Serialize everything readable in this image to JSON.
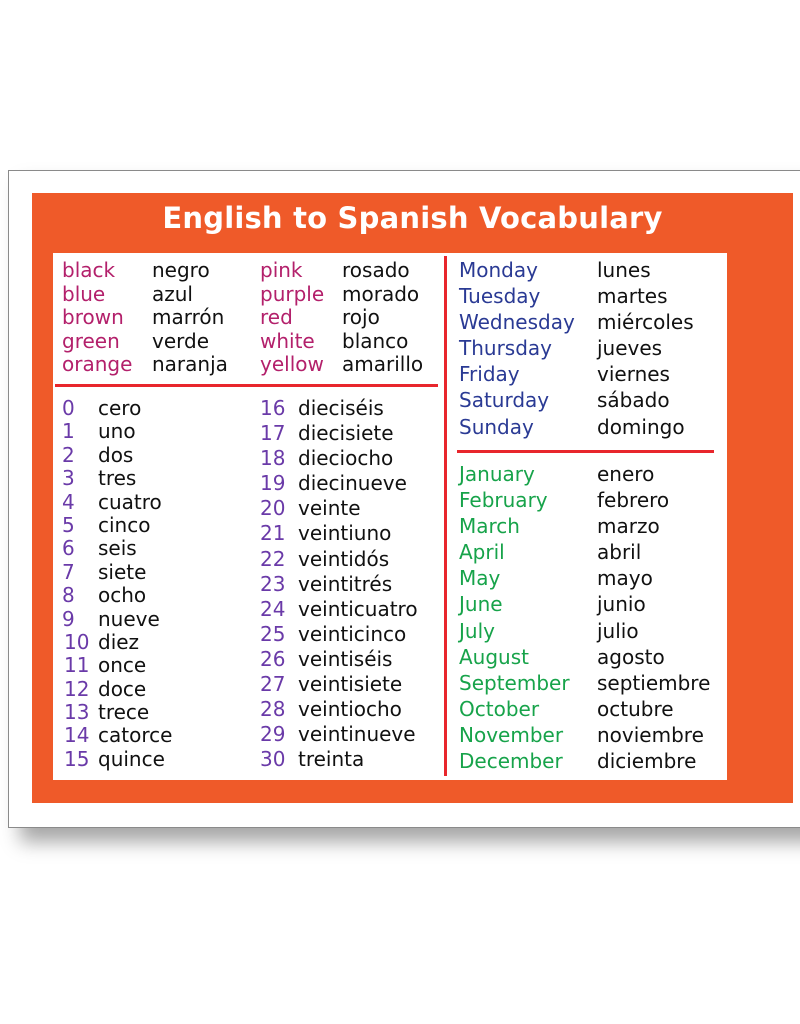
{
  "title": "English to Spanish Vocabulary",
  "theme": {
    "panel_color": "#ef5a29",
    "divider_color": "#e8262c",
    "color_words_color": "#b3206b",
    "numbers_color": "#6a3aa8",
    "days_color": "#2a3a94",
    "months_color": "#17a34a",
    "spanish_color": "#111111"
  },
  "colors_left": [
    {
      "en": "black",
      "es": "negro"
    },
    {
      "en": "blue",
      "es": "azul"
    },
    {
      "en": "brown",
      "es": "marrón"
    },
    {
      "en": "green",
      "es": "verde"
    },
    {
      "en": "orange",
      "es": "naranja"
    }
  ],
  "colors_right": [
    {
      "en": "pink",
      "es": "rosado"
    },
    {
      "en": "purple",
      "es": "morado"
    },
    {
      "en": "red",
      "es": "rojo"
    },
    {
      "en": "white",
      "es": "blanco"
    },
    {
      "en": "yellow",
      "es": "amarillo"
    }
  ],
  "numbers_left": [
    {
      "n": "0",
      "es": "cero"
    },
    {
      "n": "1",
      "es": "uno"
    },
    {
      "n": "2",
      "es": "dos"
    },
    {
      "n": "3",
      "es": "tres"
    },
    {
      "n": "4",
      "es": "cuatro"
    },
    {
      "n": "5",
      "es": "cinco"
    },
    {
      "n": "6",
      "es": "seis"
    },
    {
      "n": "7",
      "es": "siete"
    },
    {
      "n": "8",
      "es": "ocho"
    },
    {
      "n": "9",
      "es": "nueve"
    },
    {
      "n": "10",
      "es": "diez"
    },
    {
      "n": "11",
      "es": "once"
    },
    {
      "n": "12",
      "es": "doce"
    },
    {
      "n": "13",
      "es": "trece"
    },
    {
      "n": "14",
      "es": "catorce"
    },
    {
      "n": "15",
      "es": "quince"
    }
  ],
  "numbers_right": [
    {
      "n": "16",
      "es": "dieciséis"
    },
    {
      "n": "17",
      "es": "diecisiete"
    },
    {
      "n": "18",
      "es": "dieciocho"
    },
    {
      "n": "19",
      "es": "diecinueve"
    },
    {
      "n": "20",
      "es": "veinte"
    },
    {
      "n": "21",
      "es": "veintiuno"
    },
    {
      "n": "22",
      "es": "veintidós"
    },
    {
      "n": "23",
      "es": "veintitrés"
    },
    {
      "n": "24",
      "es": "veinticuatro"
    },
    {
      "n": "25",
      "es": "veinticinco"
    },
    {
      "n": "26",
      "es": "veintiséis"
    },
    {
      "n": "27",
      "es": "veintisiete"
    },
    {
      "n": "28",
      "es": "veintiocho"
    },
    {
      "n": "29",
      "es": "veintinueve"
    },
    {
      "n": "30",
      "es": "treinta"
    }
  ],
  "days": [
    {
      "en": "Monday",
      "es": "lunes"
    },
    {
      "en": "Tuesday",
      "es": "martes"
    },
    {
      "en": "Wednesday",
      "es": "miércoles"
    },
    {
      "en": "Thursday",
      "es": "jueves"
    },
    {
      "en": "Friday",
      "es": "viernes"
    },
    {
      "en": "Saturday",
      "es": "sábado"
    },
    {
      "en": "Sunday",
      "es": "domingo"
    }
  ],
  "months": [
    {
      "en": "January",
      "es": "enero"
    },
    {
      "en": "February",
      "es": "febrero"
    },
    {
      "en": "March",
      "es": "marzo"
    },
    {
      "en": "April",
      "es": "abril"
    },
    {
      "en": "May",
      "es": "mayo"
    },
    {
      "en": "June",
      "es": "junio"
    },
    {
      "en": "July",
      "es": "julio"
    },
    {
      "en": "August",
      "es": "agosto"
    },
    {
      "en": "September",
      "es": "septiembre"
    },
    {
      "en": "October",
      "es": "octubre"
    },
    {
      "en": "November",
      "es": "noviembre"
    },
    {
      "en": "December",
      "es": "diciembre"
    }
  ]
}
